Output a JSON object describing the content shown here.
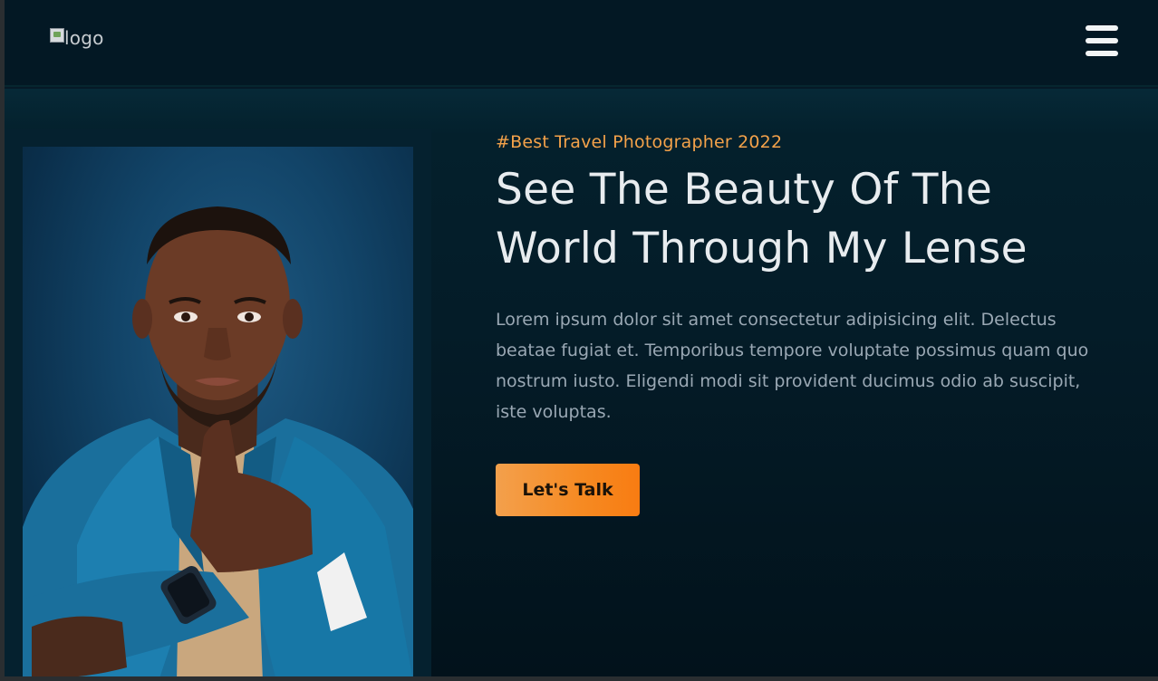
{
  "navbar": {
    "logo_alt": "logo",
    "menu_icon": "hamburger-icon"
  },
  "hero": {
    "tagline": "#Best Travel Photographer 2022",
    "headline_line1": "See The Beauty Of The",
    "headline_line2": "World Through My Lense",
    "description": "Lorem ipsum dolor sit amet consectetur adipisicing elit. Delectus beatae fugiat et. Temporibus tempore voluptate possimus quam quo nostrum iusto. Eligendi modi sit provident ducimus odio ab suscipit, iste voluptas.",
    "cta_label": "Let's Talk"
  },
  "colors": {
    "accent": "#f68a22",
    "tagline": "#f4a24a",
    "background": "#041c28"
  }
}
